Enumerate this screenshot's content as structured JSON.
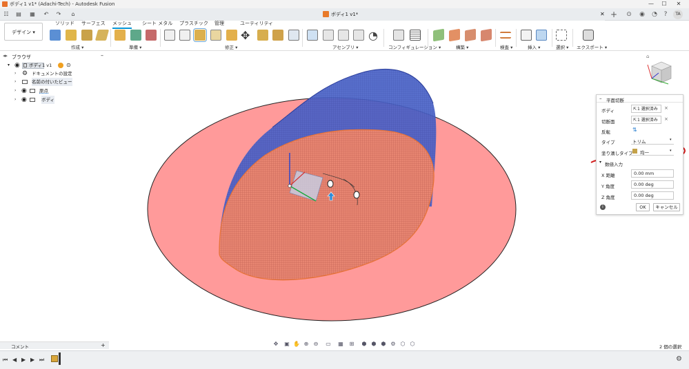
{
  "window": {
    "title": "ボディ1 v1* (Adachi-Tech) - Autodesk Fusion",
    "controls": [
      "—",
      "☐",
      "✕"
    ]
  },
  "tabbar": {
    "quick_access": [
      "☷",
      "▤",
      "▦",
      "↶",
      "↷",
      "⌂"
    ],
    "document_tab": "ボディ1 v1*",
    "close": "✕",
    "new_tab": "+",
    "right_icons": [
      "⊙",
      "◉",
      "◔",
      "?"
    ],
    "avatar": "TA"
  },
  "ribbon": {
    "workspace_button": "デザイン ▾",
    "tabs": [
      "ソリッド",
      "サーフェス",
      "メッシュ",
      "シート メタル",
      "プラスチック",
      "管理",
      "ユーティリティ"
    ],
    "active_tab": "メッシュ",
    "groups": [
      "作成 ▾",
      "準備 ▾",
      "修正 ▾",
      "アセンブリ ▾",
      "コンフィギュレーション ▾",
      "構築 ▾",
      "検査 ▾",
      "挿入 ▾",
      "選択 ▾",
      "エクスポート ▾"
    ]
  },
  "browser": {
    "title": "ブラウザ",
    "collapse": "–",
    "items": [
      {
        "label": "ボディ1 v1",
        "level": 0
      },
      {
        "label": "ドキュメントの設定",
        "level": 1
      },
      {
        "label": "名前の付いたビュー",
        "level": 1
      },
      {
        "label": "原点",
        "level": 1
      },
      {
        "label": "ボディ",
        "level": 1
      }
    ]
  },
  "dialog": {
    "title": "平面切断",
    "body_label": "ボディ",
    "body_value": "1 選択済み",
    "plane_label": "切断面",
    "plane_value": "1 選択済み",
    "flip_label": "反転",
    "type_label": "タイプ",
    "type_value": "トリム",
    "fill_label": "塗り潰しタイプ",
    "fill_value": "均一",
    "numeric_label": "数値入力",
    "x_label": "X 距離",
    "x_value": "0.00 mm",
    "y_label": "Y 角度",
    "y_value": "0.00 deg",
    "z_label": "Z 角度",
    "z_value": "0.00 deg",
    "ok": "OK",
    "cancel": "キャンセル",
    "info": "i"
  },
  "footer": {
    "comment": "コメント",
    "comment_add": "+",
    "selection_status": "2 個の選択",
    "playback": [
      "⏮",
      "◀",
      "▶",
      "▶",
      "⏭"
    ]
  },
  "colors": {
    "accent": "#0696d7",
    "plane_fill": "#ff9a9a",
    "mesh_blue": "#3c5ecc",
    "mesh_red": "#e06a5a",
    "annotation": "#d31a1a"
  }
}
